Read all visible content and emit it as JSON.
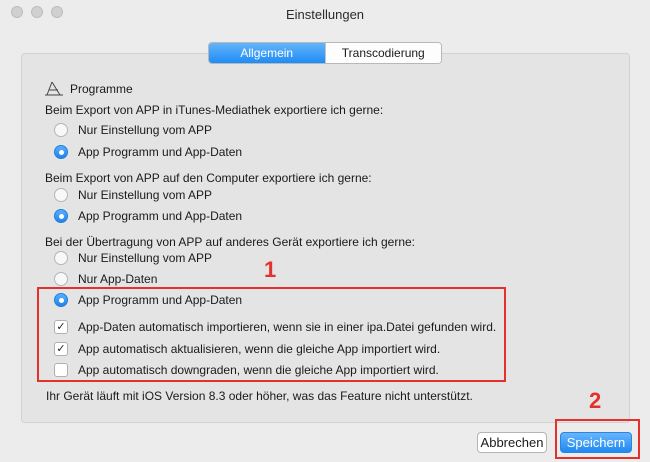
{
  "window": {
    "title": "Einstellungen"
  },
  "tabs": [
    {
      "label": "Allgemein",
      "active": true
    },
    {
      "label": "Transcodierung",
      "active": false
    }
  ],
  "section": {
    "title": "Programme",
    "icon": "app-store-icon"
  },
  "groups": [
    {
      "heading": "Beim Export von APP in iTunes-Mediathek exportiere ich gerne:",
      "options": [
        {
          "label": "Nur Einstellung vom APP",
          "selected": false
        },
        {
          "label": "App Programm und App-Daten",
          "selected": true
        }
      ]
    },
    {
      "heading": "Beim Export von APP auf den Computer exportiere ich gerne:",
      "options": [
        {
          "label": "Nur Einstellung vom APP",
          "selected": false
        },
        {
          "label": "App Programm und App-Daten",
          "selected": true
        }
      ]
    },
    {
      "heading": "Bei der Übertragung von APP auf anderes Gerät exportiere ich gerne:",
      "options": [
        {
          "label": "Nur Einstellung vom APP",
          "selected": false
        },
        {
          "label": "Nur App-Daten",
          "selected": false
        },
        {
          "label": "App Programm und App-Daten",
          "selected": true
        }
      ]
    }
  ],
  "checkboxes": [
    {
      "label": "App-Daten automatisch importieren, wenn sie in einer ipa.Datei gefunden wird.",
      "checked": true
    },
    {
      "label": "App automatisch aktualisieren, wenn die gleiche App importiert wird.",
      "checked": true
    },
    {
      "label": "App automatisch downgraden, wenn die gleiche App importiert wird.",
      "checked": false
    }
  ],
  "note": "Ihr Gerät läuft mit iOS Version 8.3 oder höher, was das Feature nicht unterstützt.",
  "buttons": {
    "cancel": "Abbrechen",
    "save": "Speichern"
  },
  "annotations": {
    "box1": "1",
    "box2": "2",
    "color": "#e4312b"
  }
}
